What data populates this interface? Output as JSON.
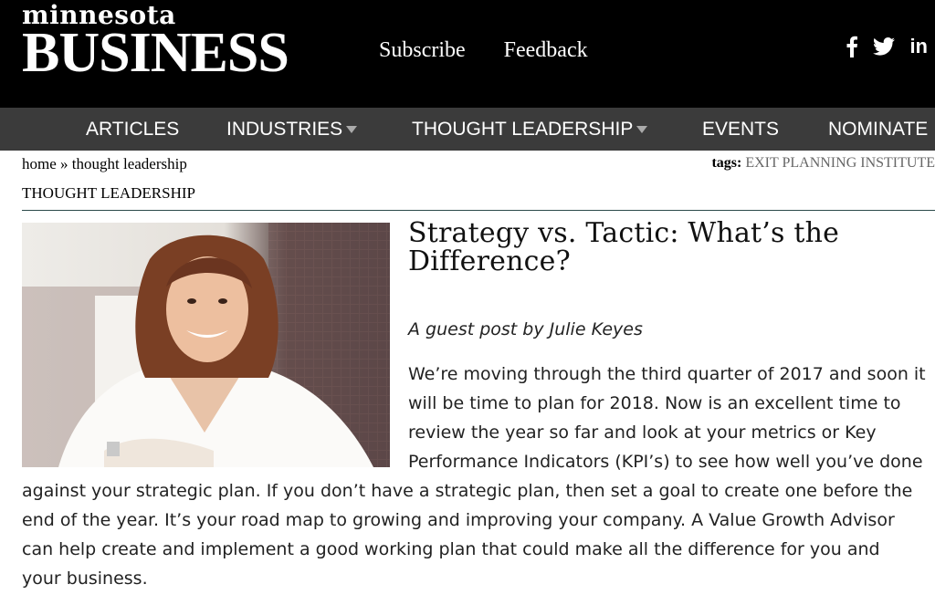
{
  "site": {
    "logo_top": "minnesota",
    "logo_bottom": "BUSINESS",
    "top_links": [
      "Subscribe",
      "Feedback"
    ],
    "social_icons": [
      "facebook-icon",
      "twitter-icon",
      "linkedin-icon"
    ],
    "social_in": "in"
  },
  "nav": {
    "items": [
      {
        "label": "ARTICLES"
      },
      {
        "label": "INDUSTRIES"
      },
      {
        "label": "THOUGHT LEADERSHIP"
      },
      {
        "label": "EVENTS"
      },
      {
        "label": "NOMINATE"
      }
    ]
  },
  "breadcrumb": {
    "home": "home",
    "sep": "»",
    "current": "thought leadership"
  },
  "tags": {
    "label": "tags:",
    "value": "EXIT PLANNING INSTITUTE"
  },
  "section_title": "THOUGHT LEADERSHIP",
  "article": {
    "title_line1": "Strategy vs. Tactic: What’s the",
    "title_line2": "Difference?",
    "byline": "A guest post by Julie Keyes",
    "lines": [
      "We’re moving through the third quarter of 2017 and soon it",
      "will be time to plan for 2018. Now is an excellent time to",
      "review the year so far and look at your metrics or Key",
      "Performance Indicators (KPI’s) to see how well you’ve done",
      "against your strategic plan. If you don’t have a strategic plan, then set a goal to create one before the",
      "end of the year.  It’s your road map to growing and improving your company. A Value Growth Advisor",
      "can help create and implement a good working plan that could make all the difference for you and",
      "your business."
    ]
  }
}
